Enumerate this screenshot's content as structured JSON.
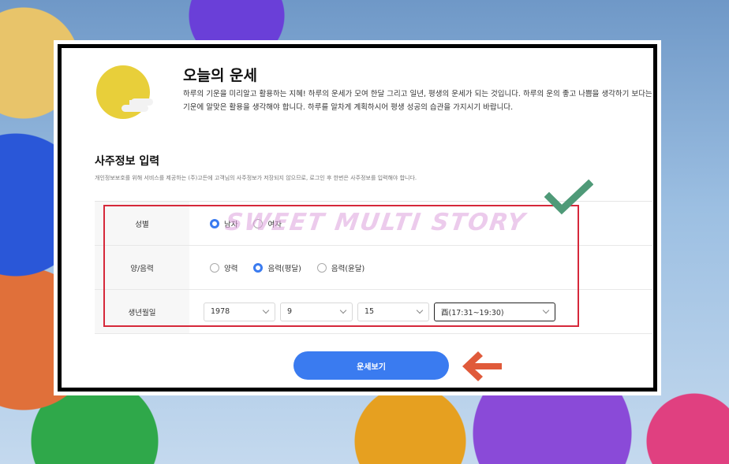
{
  "header": {
    "title": "오늘의 운세",
    "description": "하루의 기운을 미리알고 활용하는 지혜! 하루의 운세가 모여 한달 그리고 일년, 평생의 운세가 되는 것입니다. 하루의 운의 좋고 나쁨을 생각하기 보다는 기운에 알맞은 활용을 생각해야 합니다. 하루를 알차게 계획하시어 평생 성공의 습관을 가지시기 바랍니다."
  },
  "section": {
    "title": "사주정보 입력",
    "note": "개인정보보호를 위해 서비스를 제공하는 (주)고든에 고객님의 사주정보가 저장되지 않으므로, 로그인 후 한번은 사주정보를 입력해야 합니다."
  },
  "form": {
    "gender": {
      "label": "성별",
      "options": [
        {
          "label": "남자",
          "selected": true
        },
        {
          "label": "여자",
          "selected": false
        }
      ]
    },
    "calendar": {
      "label": "양/음력",
      "options": [
        {
          "label": "양력",
          "selected": false
        },
        {
          "label": "음력(평달)",
          "selected": true
        },
        {
          "label": "음력(윤달)",
          "selected": false
        }
      ]
    },
    "birth": {
      "label": "생년월일",
      "year": "1978",
      "month": "9",
      "day": "15",
      "hour": "酉(17:31~19:30)"
    }
  },
  "submit_label": "운세보기",
  "watermark": "SWEET MULTI STORY",
  "colors": {
    "accent": "#3a7bf0",
    "highlight_border": "#d6283a",
    "check": "#4f9a78",
    "arrow": "#e05a3a",
    "moon": "#e8cf3a"
  },
  "icons": [
    "moon-cloud-icon",
    "checkmark-icon",
    "left-arrow-icon",
    "chevron-down-icon"
  ]
}
